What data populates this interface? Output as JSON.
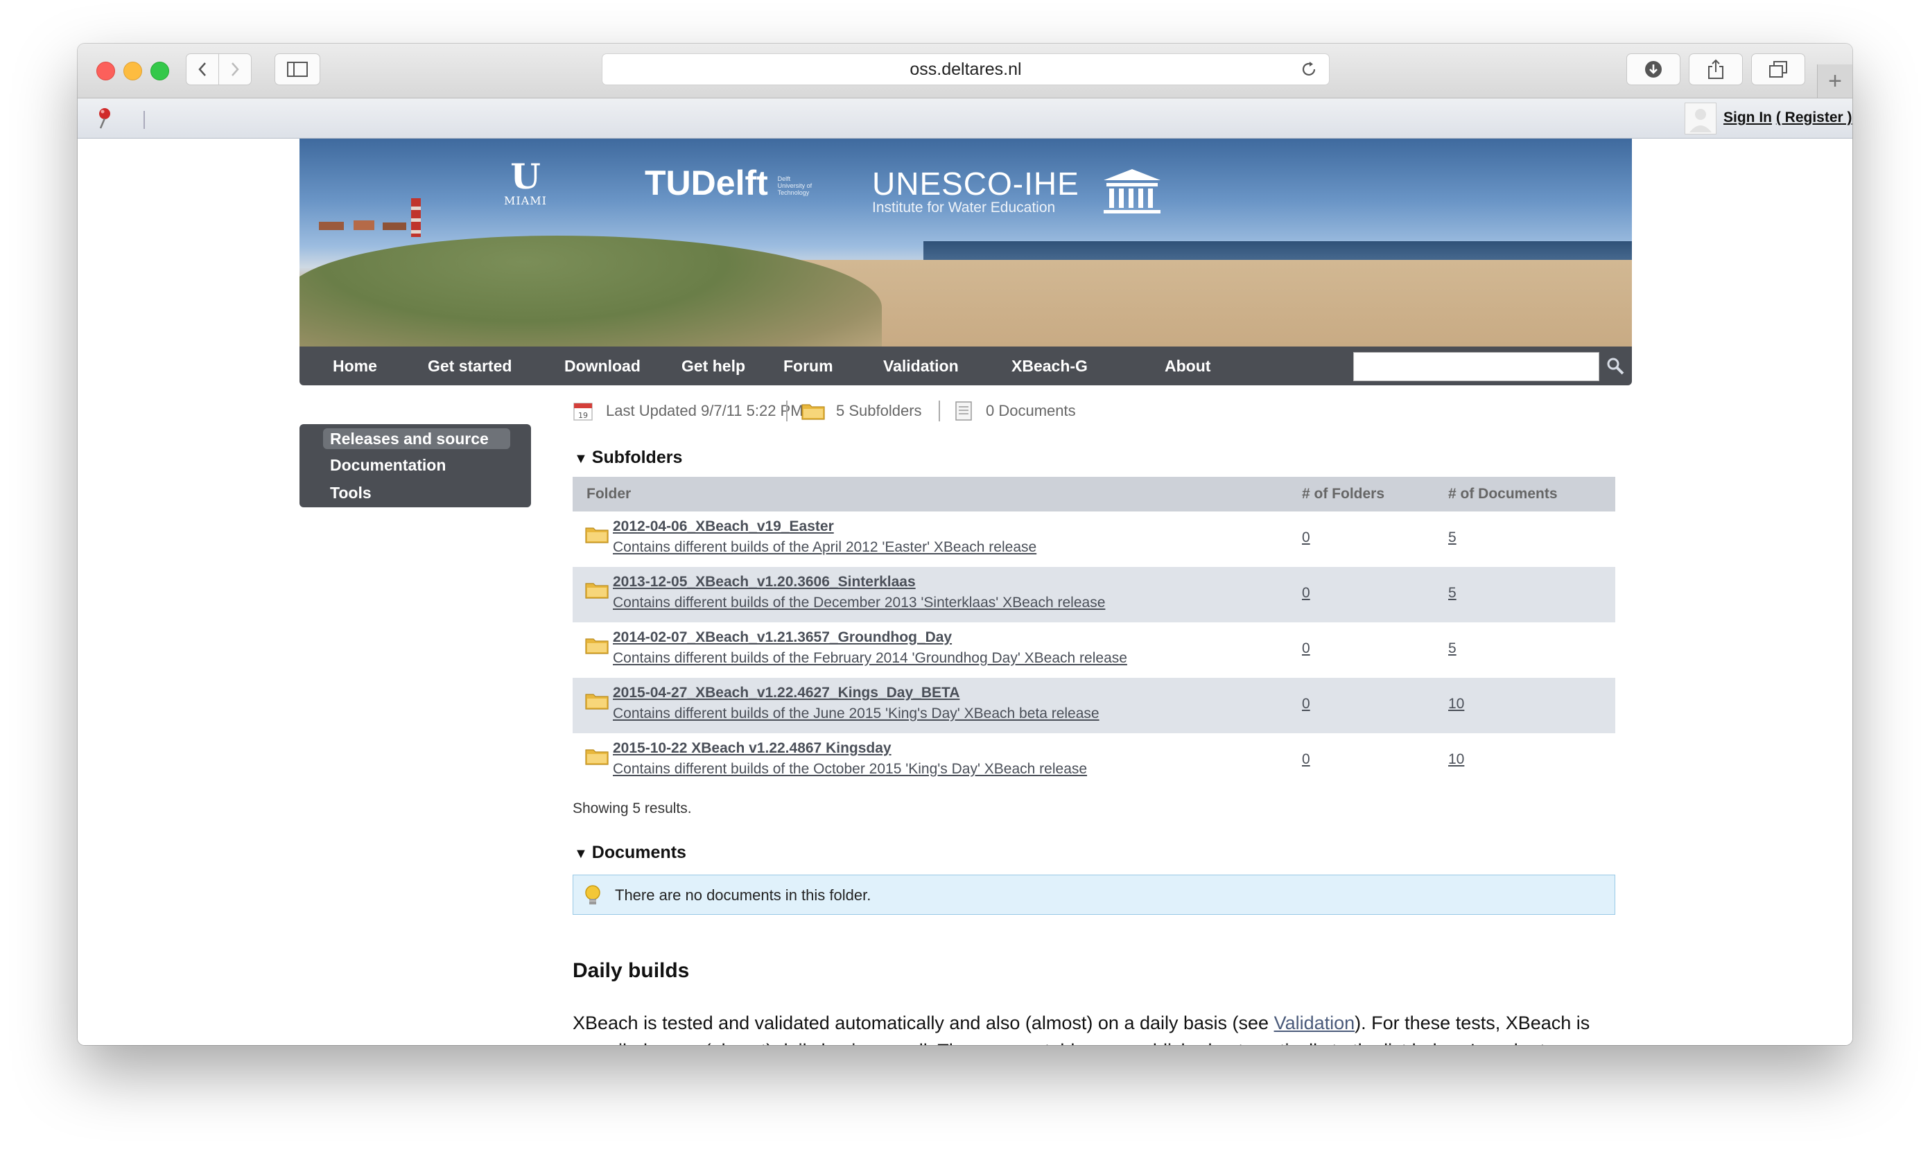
{
  "browser": {
    "url": "oss.deltares.nl",
    "signin_label": "Sign In",
    "register_label": "( Register )"
  },
  "banner": {
    "miami_letter": "U",
    "miami_text": "MIAMI",
    "tudelft_text": "TUDelft",
    "tudelft_sub": "Delft University of Technology",
    "unesco_name": "UNESCO-IHE",
    "unesco_sub": "Institute for Water Education"
  },
  "nav": {
    "items": [
      "Home",
      "Get started",
      "Download",
      "Get help",
      "Forum",
      "Validation",
      "XBeach-G",
      "About"
    ]
  },
  "sidebar": {
    "items": [
      "Releases and source",
      "Documentation",
      "Tools"
    ]
  },
  "meta": {
    "last_updated": "Last Updated 9/7/11 5:22 PM",
    "subfolders": "5 Subfolders",
    "documents": "0 Documents"
  },
  "subfolders_section": {
    "title": "Subfolders",
    "columns": [
      "Folder",
      "# of Folders",
      "# of Documents"
    ],
    "rows": [
      {
        "name": "2012-04-06_XBeach_v19_Easter",
        "desc": "Contains different builds of the April 2012 'Easter' XBeach release",
        "folders": "0",
        "documents": "5"
      },
      {
        "name": "2013-12-05_XBeach_v1.20.3606_Sinterklaas",
        "desc": "Contains different builds of the December 2013 'Sinterklaas' XBeach release",
        "folders": "0",
        "documents": "5"
      },
      {
        "name": "2014-02-07_XBeach_v1.21.3657_Groundhog_Day",
        "desc": "Contains different builds of the February 2014 'Groundhog Day' XBeach release",
        "folders": "0",
        "documents": "5"
      },
      {
        "name": "2015-04-27_XBeach_v1.22.4627_Kings_Day_BETA",
        "desc": "Contains different builds of the June 2015 'King's Day' XBeach beta release",
        "folders": "0",
        "documents": "10"
      },
      {
        "name": "2015-10-22 XBeach v1.22.4867 Kingsday",
        "desc": "Contains different builds of the October 2015 'King's Day' XBeach release",
        "folders": "0",
        "documents": "10"
      }
    ],
    "showing": "Showing 5 results."
  },
  "documents_section": {
    "title": "Documents",
    "empty_message": "There are no documents in this folder."
  },
  "daily_builds": {
    "heading": "Daily builds",
    "text_before": "XBeach is tested and validated automatically and also (almost) on a daily basis (see ",
    "link": "Validation",
    "text_after": "). For these tests, XBeach is compiled on an (almost) daily basis as well. These executables are published automatically to the list below. In order to run"
  }
}
